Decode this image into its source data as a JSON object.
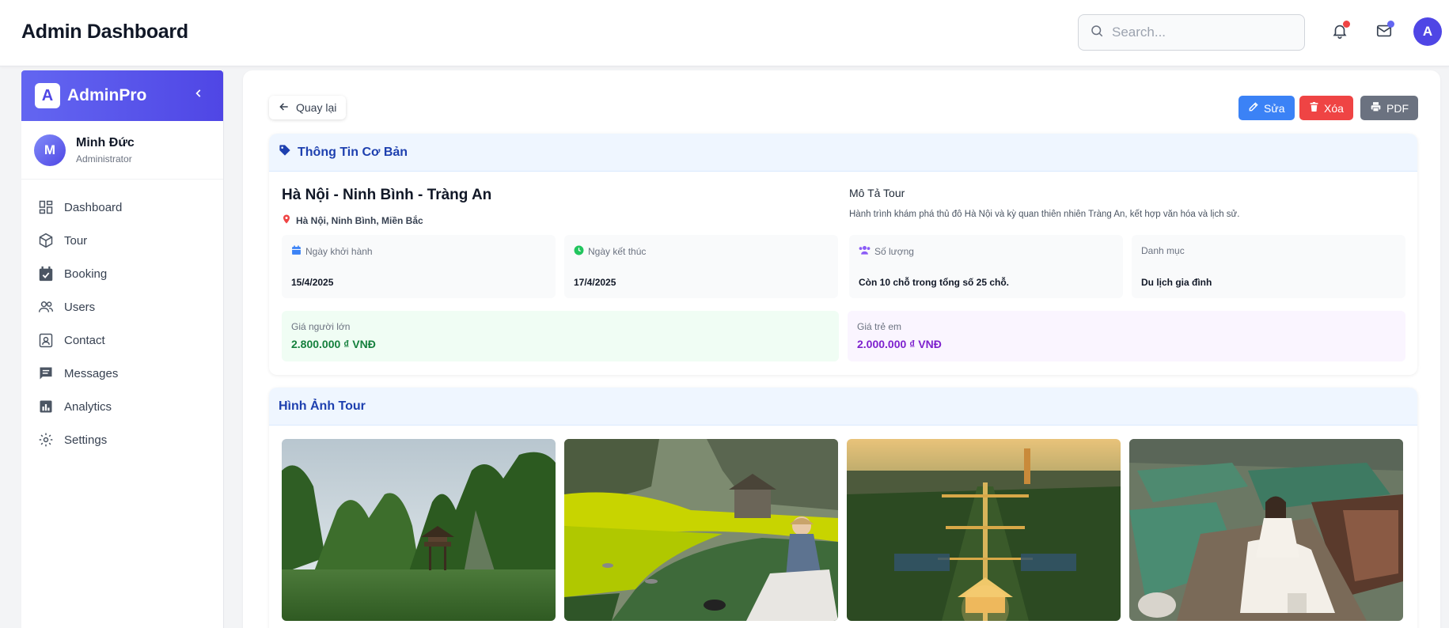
{
  "header": {
    "title": "Admin Dashboard",
    "search_placeholder": "Search...",
    "avatar_initial": "A",
    "notification_dot_color": "#ef4444",
    "mail_dot_color": "#6366f1"
  },
  "sidebar": {
    "brand_initial": "A",
    "brand_name": "AdminPro",
    "user": {
      "initial": "M",
      "name": "Minh Đức",
      "role": "Administrator"
    },
    "items": [
      {
        "label": "Dashboard",
        "icon": "dashboard-icon"
      },
      {
        "label": "Tour",
        "icon": "box-icon"
      },
      {
        "label": "Booking",
        "icon": "calendar-check-icon"
      },
      {
        "label": "Users",
        "icon": "users-icon"
      },
      {
        "label": "Contact",
        "icon": "contact-icon"
      },
      {
        "label": "Messages",
        "icon": "messages-icon"
      },
      {
        "label": "Analytics",
        "icon": "analytics-icon"
      },
      {
        "label": "Settings",
        "icon": "settings-icon"
      }
    ]
  },
  "actions": {
    "back_label": "Quay lại",
    "edit_label": "Sửa",
    "delete_label": "Xóa",
    "pdf_label": "PDF"
  },
  "basic_info": {
    "section_title": "Thông Tin Cơ Bản",
    "tour_name": "Hà Nội - Ninh Bình - Tràng An",
    "location": "Hà Nội, Ninh Bình, Miền Bắc",
    "description_title": "Mô Tả Tour",
    "description": "Hành trình khám phá thủ đô Hà Nội và kỳ quan thiên nhiên Tràng An, kết hợp văn hóa và lịch sử.",
    "start_label": "Ngày khởi hành",
    "start_value": "15/4/2025",
    "end_label": "Ngày kết thúc",
    "end_value": "17/4/2025",
    "quantity_label": "Số lượng",
    "quantity_value": "Còn 10 chỗ trong tổng số 25 chỗ.",
    "category_label": "Danh mục",
    "category_value": "Du lịch gia đình",
    "adult_price_label": "Giá người lớn",
    "adult_price_value": "2.800.000 ₫ VNĐ",
    "child_price_label": "Giá trẻ em",
    "child_price_value": "2.000.000 ₫ VNĐ"
  },
  "gallery": {
    "section_title": "Hình Ảnh Tour"
  },
  "colors": {
    "accent": "#4f46e5",
    "edit": "#3b82f6",
    "delete": "#ef4444",
    "pdf": "#6b7280",
    "adult_price": "#15803d",
    "child_price": "#7e22ce"
  }
}
